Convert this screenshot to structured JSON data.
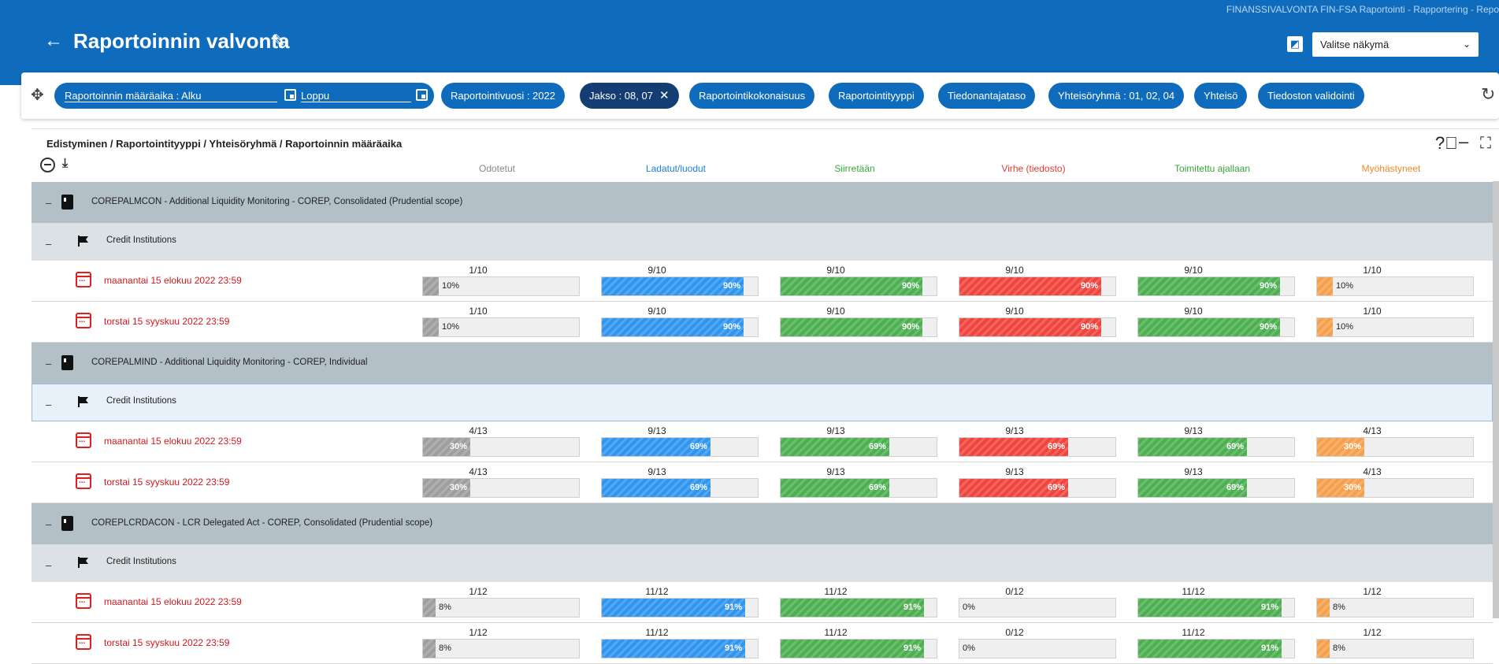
{
  "header": {
    "brand": "FINANSSIVALVONTA FIN-FSA Raportointi - Rapportering - Repo",
    "back_icon": "arrow-left-icon",
    "title": "Raportoinnin valvonta",
    "edit_icon": "pencil-icon",
    "view_icon": "view-layout-icon",
    "view_select": "Valitse näkymä"
  },
  "filters": {
    "deadline_start": "Raportoinnin määräaika : Alku",
    "deadline_end": "Loppu",
    "year": "Raportointivuosi : 2022",
    "period": "Jakso : 08, 07",
    "period_clear": "✕",
    "entity_set": "Raportointikokonaisuus",
    "report_type": "Raportointityyppi",
    "provider_level": "Tiedonantajataso",
    "group": "Yhteisöryhmä : 01, 02, 04",
    "entity": "Yhteisö",
    "validation": "Tiedoston validointi"
  },
  "panel": {
    "breadcrumb": "Edistyminen / Raportointityyppi / Yhteisöryhmä / Raportoinnin määräaika",
    "columns": [
      "Odotetut",
      "Ladatut/luodut",
      "Siirretään",
      "Virhe (tiedosto)",
      "Toimitettu ajallaan",
      "Myöhästyneet"
    ]
  },
  "colors": {
    "header_blue": "#0f6cbd",
    "gray": "#9e9e9e",
    "blue": "#2f95ef",
    "green": "#4caf50",
    "red": "#f0443c",
    "orange": "#f5a04d"
  },
  "groups": [
    {
      "toggle": "–",
      "label": "COREPALMCON - Additional Liquidity Monitoring - COREP, Consolidated (Prudential scope)",
      "sub": {
        "toggle": "–",
        "label": "Credit Institutions",
        "selected": false
      },
      "rows": [
        {
          "date": "maanantai 15 elokuu 2022 23:59",
          "cells": [
            {
              "frac": "1/10",
              "pct": 10,
              "label": "10%"
            },
            {
              "frac": "9/10",
              "pct": 90,
              "label": "90%"
            },
            {
              "frac": "9/10",
              "pct": 90,
              "label": "90%"
            },
            {
              "frac": "9/10",
              "pct": 90,
              "label": "90%"
            },
            {
              "frac": "9/10",
              "pct": 90,
              "label": "90%"
            },
            {
              "frac": "1/10",
              "pct": 10,
              "label": "10%"
            }
          ]
        },
        {
          "date": "torstai 15 syyskuu 2022 23:59",
          "cells": [
            {
              "frac": "1/10",
              "pct": 10,
              "label": "10%"
            },
            {
              "frac": "9/10",
              "pct": 90,
              "label": "90%"
            },
            {
              "frac": "9/10",
              "pct": 90,
              "label": "90%"
            },
            {
              "frac": "9/10",
              "pct": 90,
              "label": "90%"
            },
            {
              "frac": "9/10",
              "pct": 90,
              "label": "90%"
            },
            {
              "frac": "1/10",
              "pct": 10,
              "label": "10%"
            }
          ]
        }
      ]
    },
    {
      "toggle": "–",
      "label": "COREPALMIND - Additional Liquidity Monitoring - COREP, Individual",
      "sub": {
        "toggle": "–",
        "label": "Credit Institutions",
        "selected": true
      },
      "rows": [
        {
          "date": "maanantai 15 elokuu 2022 23:59",
          "cells": [
            {
              "frac": "4/13",
              "pct": 30,
              "label": "30%"
            },
            {
              "frac": "9/13",
              "pct": 69,
              "label": "69%"
            },
            {
              "frac": "9/13",
              "pct": 69,
              "label": "69%"
            },
            {
              "frac": "9/13",
              "pct": 69,
              "label": "69%"
            },
            {
              "frac": "9/13",
              "pct": 69,
              "label": "69%"
            },
            {
              "frac": "4/13",
              "pct": 30,
              "label": "30%"
            }
          ]
        },
        {
          "date": "torstai 15 syyskuu 2022 23:59",
          "cells": [
            {
              "frac": "4/13",
              "pct": 30,
              "label": "30%"
            },
            {
              "frac": "9/13",
              "pct": 69,
              "label": "69%"
            },
            {
              "frac": "9/13",
              "pct": 69,
              "label": "69%"
            },
            {
              "frac": "9/13",
              "pct": 69,
              "label": "69%"
            },
            {
              "frac": "9/13",
              "pct": 69,
              "label": "69%"
            },
            {
              "frac": "4/13",
              "pct": 30,
              "label": "30%"
            }
          ]
        }
      ]
    },
    {
      "toggle": "–",
      "label": "COREPLCRDACON - LCR Delegated Act - COREP, Consolidated (Prudential scope)",
      "sub": {
        "toggle": "–",
        "label": "Credit Institutions",
        "selected": false
      },
      "rows": [
        {
          "date": "maanantai 15 elokuu 2022 23:59",
          "cells": [
            {
              "frac": "1/12",
              "pct": 8,
              "label": "8%"
            },
            {
              "frac": "11/12",
              "pct": 91,
              "label": "91%"
            },
            {
              "frac": "11/12",
              "pct": 91,
              "label": "91%"
            },
            {
              "frac": "0/12",
              "pct": 0,
              "label": "0%"
            },
            {
              "frac": "11/12",
              "pct": 91,
              "label": "91%"
            },
            {
              "frac": "1/12",
              "pct": 8,
              "label": "8%"
            }
          ]
        },
        {
          "date": "torstai 15 syyskuu 2022 23:59",
          "cells": [
            {
              "frac": "1/12",
              "pct": 8,
              "label": "8%"
            },
            {
              "frac": "11/12",
              "pct": 91,
              "label": "91%"
            },
            {
              "frac": "11/12",
              "pct": 91,
              "label": "91%"
            },
            {
              "frac": "0/12",
              "pct": 0,
              "label": "0%"
            },
            {
              "frac": "11/12",
              "pct": 91,
              "label": "91%"
            },
            {
              "frac": "1/12",
              "pct": 8,
              "label": "8%"
            }
          ]
        }
      ]
    }
  ]
}
